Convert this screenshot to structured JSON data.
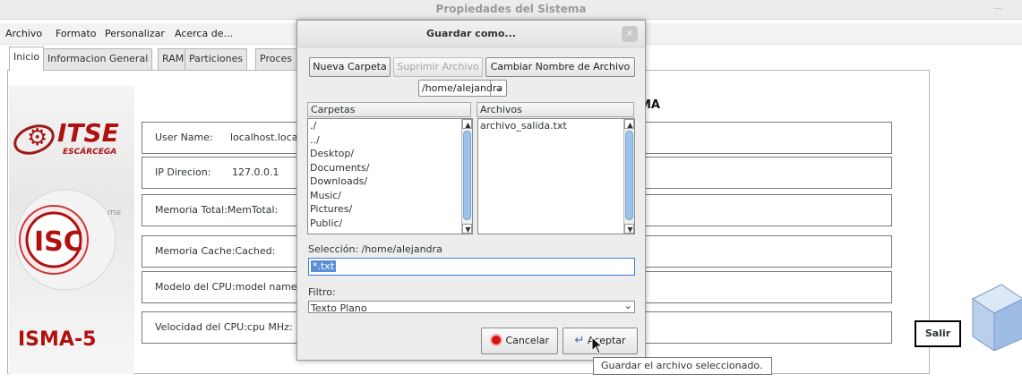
{
  "window": {
    "title": "Propiedades del Sistema"
  },
  "menu": [
    "Archivo",
    "Formato",
    "Personalizar",
    "Acerca de..."
  ],
  "tabs": [
    "Inicio",
    "Informacion General",
    "RAM",
    "Particiones",
    "Proces"
  ],
  "logo": {
    "itse": "ITSE",
    "subtitle": "ESCÁRCEGA",
    "isc": "ISC",
    "itse_small": "ITSE",
    "brand": "ISMA-5"
  },
  "heading_partial": "MA",
  "info_rows": [
    {
      "label": "User Name:",
      "value": "localhost.loca"
    },
    {
      "label": "IP Direcion:",
      "value": "127.0.0.1"
    },
    {
      "label": "Memoria Total:MemTotal:",
      "value": ""
    },
    {
      "label": "Memoria Cache:Cached:",
      "value": ""
    },
    {
      "label": "Modelo del CPU:model name",
      "value": ""
    },
    {
      "label": "Velocidad del CPU:cpu MHz:",
      "value": ""
    }
  ],
  "salir_label": "Salir",
  "dialog": {
    "title": "Guardar como...",
    "close_icon": "×",
    "new_folder": "Nueva Carpeta",
    "delete_file": "Suprimir Archivo",
    "rename_file": "Cambiar Nombre de Archivo",
    "path": "/home/alejandra",
    "folders_header": "Carpetas",
    "files_header": "Archivos",
    "folders": [
      "./",
      "../",
      "Desktop/",
      "Documents/",
      "Downloads/",
      "Music/",
      "Pictures/",
      "Public/"
    ],
    "files": [
      "archivo_salida.txt"
    ],
    "selection_label": "Selección: /home/alejandra",
    "selection_value": "*.txt",
    "filter_label": "Filtro:",
    "filter_value": "Texto Plano",
    "cancel": "Cancelar",
    "accept": "Aceptar"
  },
  "tooltip": "Guardar el archivo seleccionado.",
  "colors": {
    "accent": "#3d7bd6",
    "logo_red": "#b01010",
    "selection_bg": "#5a8ed6"
  }
}
